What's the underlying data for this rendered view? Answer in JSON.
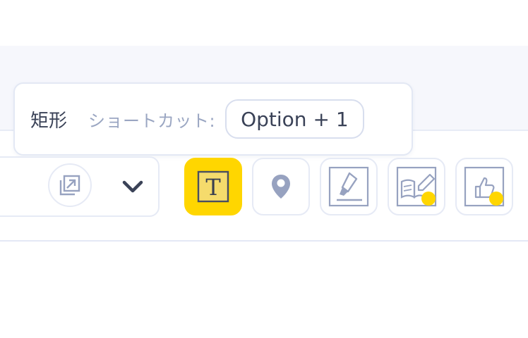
{
  "tooltip": {
    "title": "矩形",
    "shortcut_label": "ショートカット:",
    "shortcut_key": "Option + 1"
  },
  "toolbar": {
    "left_icons": [
      "external-window-icon",
      "chevron-down-icon"
    ],
    "tools": [
      {
        "name": "text-tool",
        "icon": "text-t-icon",
        "active": true,
        "badge": false
      },
      {
        "name": "pin-tool",
        "icon": "map-pin-icon",
        "active": false,
        "badge": false
      },
      {
        "name": "highlighter-tool",
        "icon": "highlighter-icon",
        "active": false,
        "badge": false
      },
      {
        "name": "reading-tool",
        "icon": "book-pen-icon",
        "active": false,
        "badge": true
      },
      {
        "name": "thumbs-up-tool",
        "icon": "thumbs-up-icon",
        "active": false,
        "badge": true
      }
    ]
  },
  "colors": {
    "accent_yellow": "#ffd600",
    "icon_gray": "#97a2c0",
    "text_dark": "#3a4257",
    "text_muted": "#9aa6c2"
  }
}
